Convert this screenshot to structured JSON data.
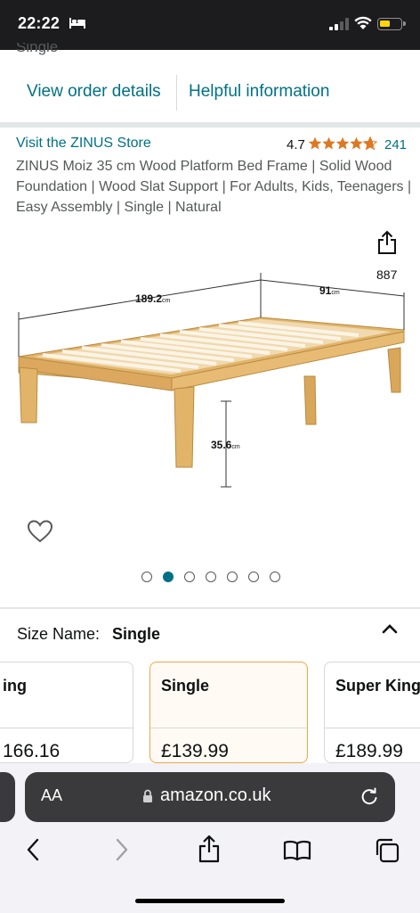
{
  "status_bar": {
    "time": "22:22"
  },
  "prev_text": "Single",
  "links": {
    "view_order": "View order details",
    "helpful": "Helpful information"
  },
  "product": {
    "store": "Visit the ZINUS Store",
    "rating": "4.7",
    "rating_count": "241",
    "title": "ZINUS Moiz 35 cm Wood Platform Bed Frame | Solid Wood Foundation | Wood Slat Support | For Adults, Kids, Teenagers | Easy Assembly | Single | Natural",
    "share_count": "887",
    "dimensions": {
      "length": "189.2",
      "width": "91",
      "height": "35.6",
      "unit": "cm"
    }
  },
  "carousel": {
    "count": 7,
    "active_index": 1
  },
  "size": {
    "label": "Size Name:",
    "selected": "Single",
    "options": [
      {
        "name": "ing",
        "price": "166.16"
      },
      {
        "name": "Single",
        "price": "£139.99"
      },
      {
        "name": "Super King",
        "price": "£189.99"
      }
    ]
  },
  "browser": {
    "text_size": "AA",
    "url": "amazon.co.uk"
  },
  "colors": {
    "link": "#007185",
    "star": "#de7921",
    "selected_border": "#f0a54a",
    "status_bar": "#1c1c1e"
  }
}
